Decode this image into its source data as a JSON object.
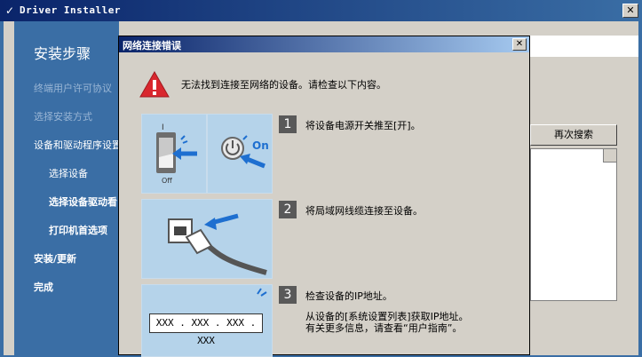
{
  "app": {
    "title": "Driver Installer",
    "close_glyph": "✕"
  },
  "sidebar": {
    "heading": "安装步骤",
    "steps": [
      {
        "label": "终端用户许可协议"
      },
      {
        "label": "选择安装方式"
      },
      {
        "label": "设备和驱动程序设置"
      },
      {
        "label": "选择设备"
      },
      {
        "label": "选择设备驱动看"
      },
      {
        "label": "打印机首选项"
      },
      {
        "label": "安装/更新"
      },
      {
        "label": "完成"
      }
    ]
  },
  "main": {
    "search_again_label": "再次搜索"
  },
  "dialog": {
    "title": "网络连接错误",
    "close_glyph": "✕",
    "message": "无法找到连接至网络的设备。请检查以下内容。",
    "steps": [
      {
        "number": "1",
        "text": "将设备电源开关推至[开]。",
        "switch_on": "On",
        "switch_i": "I",
        "switch_off": "Off"
      },
      {
        "number": "2",
        "text": "将局域网线缆连接至设备。"
      },
      {
        "number": "3",
        "text": "检查设备的IP地址。",
        "detail1": "从设备的[系统设置列表]获取IP地址。",
        "detail2": "有关更多信息，请查看“用户指南”。",
        "ip_placeholder": "XXX . XXX . XXX . XXX"
      }
    ]
  },
  "colors": {
    "desktop_blue": "#3a6ea5",
    "title_blue": "#0a246a",
    "panel_blue": "#b5d3ea",
    "warning_red": "#d9272e",
    "arrow_blue": "#1e6fd0"
  }
}
